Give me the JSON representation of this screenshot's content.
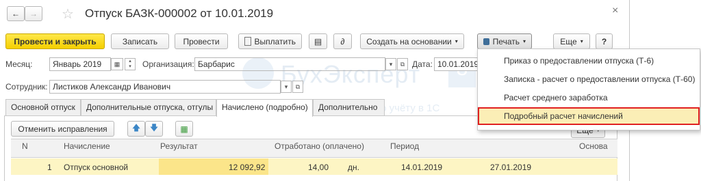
{
  "window": {
    "title": "Отпуск БАЗК-000002 от 10.01.2019",
    "close_glyph": "×"
  },
  "toolbar": {
    "post_close": "Провести и закрыть",
    "save": "Записать",
    "post": "Провести",
    "pay": "Выплатить",
    "create_based": "Создать на основании",
    "print": "Печать",
    "more": "Еще",
    "help": "?"
  },
  "form": {
    "month_label": "Месяц:",
    "month_value": "Январь 2019",
    "org_label": "Организация:",
    "org_value": "Барбарис",
    "date_label": "Дата:",
    "date_value": "10.01.2019",
    "employee_label": "Сотрудник:",
    "employee_value": "Листиков Александр Иванович"
  },
  "watermark": {
    "brand": "БухЭксперт",
    "digit": "8",
    "tagline": "по учёту в 1С"
  },
  "tabs": [
    {
      "label": "Основной отпуск"
    },
    {
      "label": "Дополнительные отпуска, отгулы"
    },
    {
      "label": "Начислено (подробно)"
    },
    {
      "label": "Дополнительно"
    }
  ],
  "table_toolbar": {
    "undo_corrections": "Отменить исправления",
    "more": "Еще"
  },
  "table": {
    "columns": [
      "N",
      "Начисление",
      "Результат",
      "Отработано (оплачено)",
      "Период",
      "Основа"
    ],
    "rows": [
      {
        "n": "1",
        "accrual": "Отпуск основной",
        "result": "12 092,92",
        "worked": "14,00",
        "unit": "дн.",
        "period_from": "14.01.2019",
        "period_to": "27.01.2019"
      }
    ]
  },
  "print_menu": {
    "items": [
      {
        "label": "Приказ о предоставлении отпуска (Т-6)"
      },
      {
        "label": "Записка - расчет о предоставлении отпуска (Т-60)"
      },
      {
        "label": "Расчет среднего заработка"
      },
      {
        "label": "Подробный расчет начислений"
      }
    ]
  },
  "colors": {
    "primary_button": "#f5cf00",
    "highlight_row": "#fdf5c4",
    "menu_highlight": "#fbeeb6",
    "highlight_border": "#e02020",
    "arrow_blue": "#3b86c6"
  }
}
